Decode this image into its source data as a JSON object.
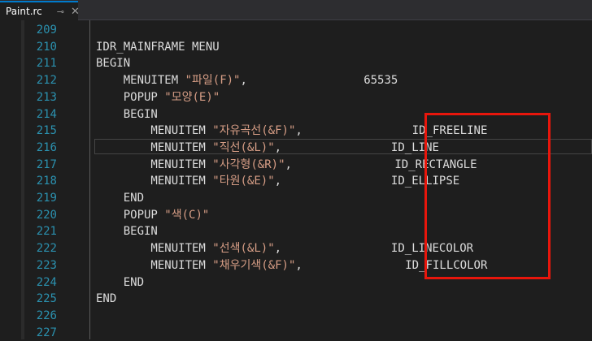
{
  "tab": {
    "title": "Paint.rc",
    "pin_icon": "pin-icon",
    "close_icon": "close-icon"
  },
  "lines": [
    {
      "num": "209",
      "text": ""
    },
    {
      "num": "210",
      "text": "IDR_MAINFRAME MENU"
    },
    {
      "num": "211",
      "text": "BEGIN"
    },
    {
      "num": "212",
      "kw": "    MENUITEM ",
      "str": "\"파일(F)\"",
      "rest": ",                 65535"
    },
    {
      "num": "213",
      "kw": "    POPUP ",
      "str": "\"모양(E)\"",
      "rest": ""
    },
    {
      "num": "214",
      "text": "    BEGIN"
    },
    {
      "num": "215",
      "kw": "        MENUITEM ",
      "str": "\"자유곡선(&F)\"",
      "rest": ",                ID_FREELINE"
    },
    {
      "num": "216",
      "kw": "        MENUITEM ",
      "str": "\"직선(&L)\"",
      "rest": ",                ID_LINE"
    },
    {
      "num": "217",
      "kw": "        MENUITEM ",
      "str": "\"사각형(&R)\"",
      "rest": ",               ID_RECTANGLE"
    },
    {
      "num": "218",
      "kw": "        MENUITEM ",
      "str": "\"타원(&E)\"",
      "rest": ",                ID_ELLIPSE"
    },
    {
      "num": "219",
      "text": "    END"
    },
    {
      "num": "220",
      "kw": "    POPUP ",
      "str": "\"색(C)\"",
      "rest": ""
    },
    {
      "num": "221",
      "text": "    BEGIN"
    },
    {
      "num": "222",
      "kw": "        MENUITEM ",
      "str": "\"선색(&L)\"",
      "rest": ",                ID_LINECOLOR"
    },
    {
      "num": "223",
      "kw": "        MENUITEM ",
      "str": "\"채우기색(&F)\"",
      "rest": ",               ID_FILLCOLOR"
    },
    {
      "num": "224",
      "text": "    END"
    },
    {
      "num": "225",
      "text": "END"
    },
    {
      "num": "226",
      "text": ""
    },
    {
      "num": "227",
      "text": ""
    }
  ],
  "colors": {
    "background": "#1e1e1e",
    "line_number": "#2b91af",
    "string": "#d69d85",
    "highlight_box": "#e8160c"
  }
}
